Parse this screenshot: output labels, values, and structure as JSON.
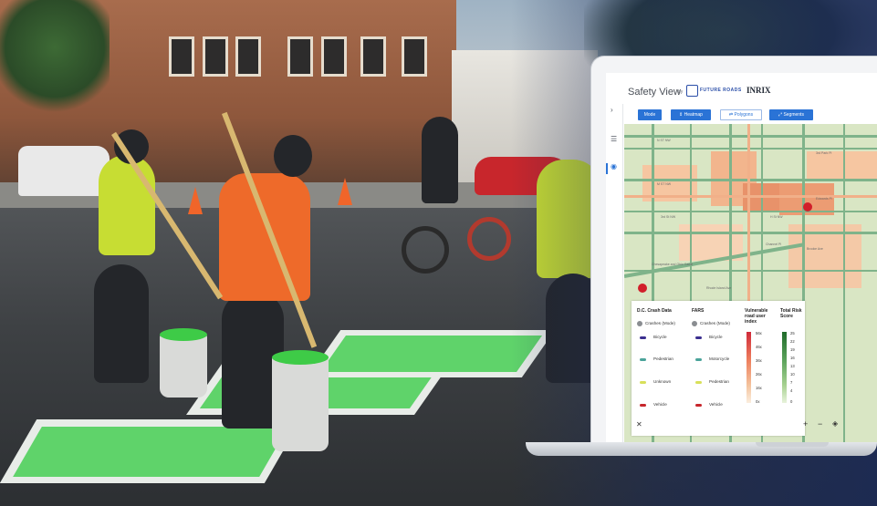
{
  "app": {
    "title": "Safety View",
    "by": "by",
    "partner_logo_text": "FUTURE ROADS",
    "brand": "INRIX"
  },
  "rail": {
    "icons": [
      "chevron-right-icon",
      "list-icon",
      "eye-icon"
    ],
    "glyphs": [
      "›",
      "☰",
      "◉"
    ]
  },
  "toolbar": {
    "buttons": [
      {
        "label": "Mode",
        "icon": ""
      },
      {
        "label": "Heatmap",
        "icon": "⇕"
      },
      {
        "label": "Polygons",
        "icon": "⇄"
      },
      {
        "label": "Segments",
        "icon": "⤢"
      }
    ]
  },
  "map": {
    "labels": [
      "N ST NW",
      "M ST NW",
      "3rd St NW",
      "H St NW",
      "Edwards Pl",
      "3rd Park Pl",
      "Channel Pl",
      "Brooke Ave",
      "Chesapeake and Ohio Canal",
      "Rhode Island Ave"
    ]
  },
  "legend": {
    "col1_title": "D.C. Crash Data",
    "col2_title": "FARS",
    "col3_title": "Vulnerable road user index",
    "col4_title": "Total Risk Score",
    "crashes_label": "Crashes (Mode)",
    "col1_items": [
      "Bicycle",
      "Pedestrian",
      "Unknown",
      "Vehicle"
    ],
    "col2_items": [
      "Bicycle",
      "Motorcycle",
      "Pedestrian",
      "Vehicle"
    ],
    "item_colors": [
      "#3b2f8f",
      "#4aa39a",
      "#d8e05a",
      "#c7262c"
    ],
    "vru_ticks": [
      "56x",
      "46x",
      "36x",
      "26x",
      "16x",
      "0x"
    ],
    "risk_ticks": [
      "25",
      "22",
      "19",
      "16",
      "13",
      "10",
      "7",
      "4",
      "0"
    ]
  },
  "map_controls": {
    "close": "✕",
    "zoom_in": "+",
    "zoom_out": "−",
    "layers": "◈"
  },
  "colors": {
    "accent": "#2a73d6",
    "crosswalk_green": "#5fd36a",
    "vest_orange": "#ee6a2a",
    "vest_yellow": "#c7dd33"
  }
}
